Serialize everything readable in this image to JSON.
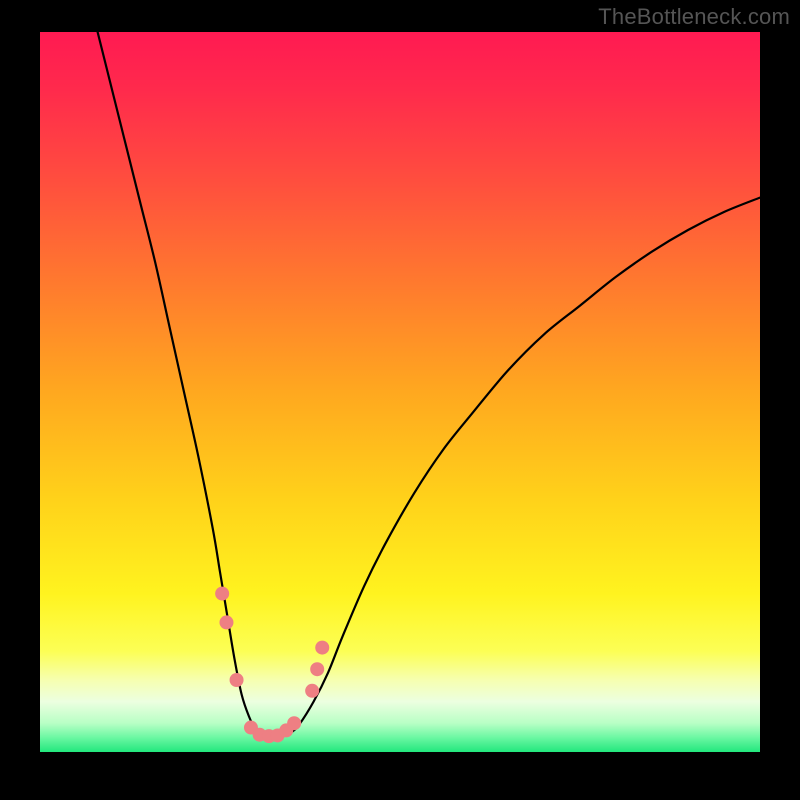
{
  "watermark": "TheBottleneck.com",
  "colors": {
    "curve": "#000000",
    "markers": "#ee7f83",
    "gradient_top": "#ff1a52",
    "gradient_bottom": "#22e77d"
  },
  "chart_data": {
    "type": "line",
    "title": "",
    "xlabel": "",
    "ylabel": "",
    "xlim": [
      0,
      100
    ],
    "ylim": [
      0,
      100
    ],
    "series": [
      {
        "name": "bottleneck-curve",
        "x": [
          8,
          10,
          12,
          14,
          16,
          18,
          20,
          22,
          24,
          25,
          26,
          27,
          28,
          29,
          30,
          31,
          32,
          33,
          34,
          35,
          36,
          38,
          40,
          42,
          45,
          48,
          52,
          56,
          60,
          65,
          70,
          75,
          80,
          85,
          90,
          95,
          100
        ],
        "y": [
          100,
          92,
          84,
          76,
          68,
          59,
          50,
          41,
          31,
          25,
          19,
          13,
          8,
          5,
          3,
          2.2,
          2,
          2,
          2.3,
          2.8,
          3.8,
          7,
          11,
          16,
          23,
          29,
          36,
          42,
          47,
          53,
          58,
          62,
          66,
          69.5,
          72.5,
          75,
          77
        ]
      }
    ],
    "markers": {
      "color": "#ee7f83",
      "radius_px": 7,
      "points": [
        {
          "x": 25.3,
          "y": 22
        },
        {
          "x": 25.9,
          "y": 18
        },
        {
          "x": 27.3,
          "y": 10
        },
        {
          "x": 29.3,
          "y": 3.4
        },
        {
          "x": 30.5,
          "y": 2.4
        },
        {
          "x": 31.8,
          "y": 2.2
        },
        {
          "x": 33.0,
          "y": 2.3
        },
        {
          "x": 34.2,
          "y": 3.0
        },
        {
          "x": 35.3,
          "y": 4.0
        },
        {
          "x": 37.8,
          "y": 8.5
        },
        {
          "x": 38.5,
          "y": 11.5
        },
        {
          "x": 39.2,
          "y": 14.5
        }
      ]
    }
  }
}
